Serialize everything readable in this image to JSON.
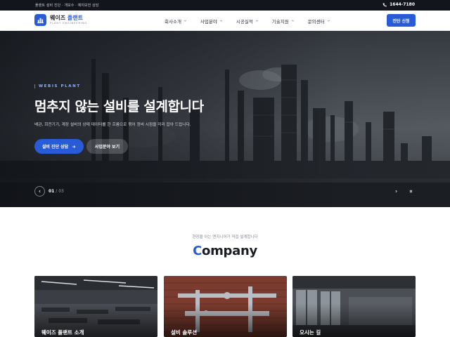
{
  "topbar": {
    "notice": "플랜트 설비 진단 · 개보수 · 예지보전 상담",
    "phone": "1644-7180",
    "phone_icon": "phone-icon"
  },
  "header": {
    "logo_name_main": "웨이즈 ",
    "logo_name_accent": "플랜트",
    "logo_sub": "PLANT ENGINEERING",
    "nav": [
      {
        "label": "회사소개"
      },
      {
        "label": "사업분야"
      },
      {
        "label": "시공실적"
      },
      {
        "label": "기술지원"
      },
      {
        "label": "문의센터"
      }
    ],
    "cta_label": "진단 신청"
  },
  "hero": {
    "tag": "WEBIS PLANT",
    "title": "멈추지 않는 설비를 설계합니다",
    "description": "배관, 회전기기, 계장 설비의 상태 데이터를 한 흐름으로 묶어 정비 시점을 미리 잡아 드립니다.",
    "primary_button": "설비 진단 상담",
    "secondary_button": "사업분야 보기",
    "slide_current": "01",
    "slide_separator": " / ",
    "slide_total": "03",
    "colors": {
      "accent": "#2a5bd7",
      "tag": "#8fb0ff"
    }
  },
  "company": {
    "subtitle": "현장을 아는 엔지니어가 직접 설계합니다",
    "title_first": "C",
    "title_rest": "ompany",
    "cards": [
      {
        "label": "웨이즈 플랜트 소개"
      },
      {
        "label": "설비 솔루션"
      },
      {
        "label": "오시는 길"
      }
    ]
  }
}
